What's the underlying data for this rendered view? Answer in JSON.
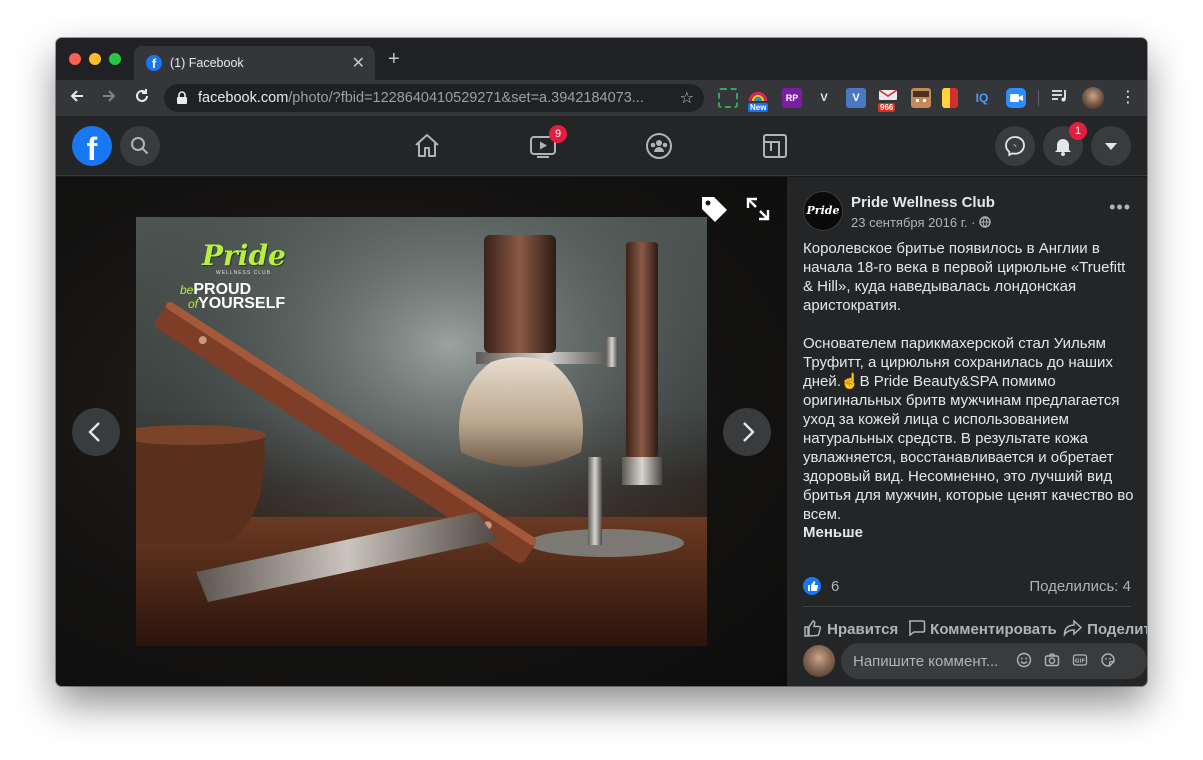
{
  "browser": {
    "tab_title": "(1) Facebook",
    "tab_favicon_letter": "f",
    "url_host": "facebook.com",
    "url_path": "/photo/?fbid=1228640410529271&set=a.3942184073...",
    "extensions": [
      {
        "name": "screenshot-ext",
        "label": "",
        "color": "#35363a",
        "border": "#34a853"
      },
      {
        "name": "new-ext",
        "label": "",
        "badge": "New",
        "color": "#35363a"
      },
      {
        "name": "rp-ext",
        "label": "RP",
        "color": "#7b1fa2"
      },
      {
        "name": "vue-ext",
        "label": "V",
        "color": "#35363a"
      },
      {
        "name": "v-ext",
        "label": "V",
        "color": "#4a78c2"
      },
      {
        "name": "mail-ext",
        "label": "",
        "badge": "966",
        "color": "#35363a"
      },
      {
        "name": "face-ext",
        "label": "",
        "color": "#c58a5a"
      },
      {
        "name": "flag-ext",
        "label": "",
        "color": "#ffd43b"
      },
      {
        "name": "iq-ext",
        "label": "IQ",
        "color": "#35363a"
      },
      {
        "name": "zoom-ext",
        "label": "",
        "color": "#2d8cff"
      }
    ]
  },
  "fb_header": {
    "logo_letter": "f",
    "watch_badge": "9",
    "notifications_badge": "1"
  },
  "photo": {
    "overlay_brand": "Pride",
    "overlay_sub": "WELLNESS CLUB",
    "overlay_line1_small": "be",
    "overlay_line1": "PROUD",
    "overlay_line2_small": "of",
    "overlay_line2": "YOURSELF"
  },
  "post": {
    "avatar_text": "Pride",
    "page_name": "Pride Wellness Club",
    "date": "23 сентября 2016 г. ·",
    "text": "Королевское бритье появилось в Англии в начала 18-го века в первой цирюльне «Truefitt & Hill», куда наведывалась лондонская аристократия.\n\nОснователем парикмахерской стал Уильям Труфитт, а цирюльня сохранилась до наших дней.☝️В Pride Beauty&SPA помимо оригинальных бритв мужчинам предлагается уход за кожей лица с использованием натуральных средств. В результате кожа увлажняется, восстанавливается и обретает здоровый вид. Несомненно, это лучший вид бритья для мужчин, которые ценят качество во всем.",
    "see_less": "Меньше",
    "like_count": "6",
    "shares": "Поделились: 4",
    "actions": {
      "like": "Нравится",
      "comment": "Комментировать",
      "share": "Поделиться"
    },
    "comment_placeholder": "Напишите коммент..."
  }
}
